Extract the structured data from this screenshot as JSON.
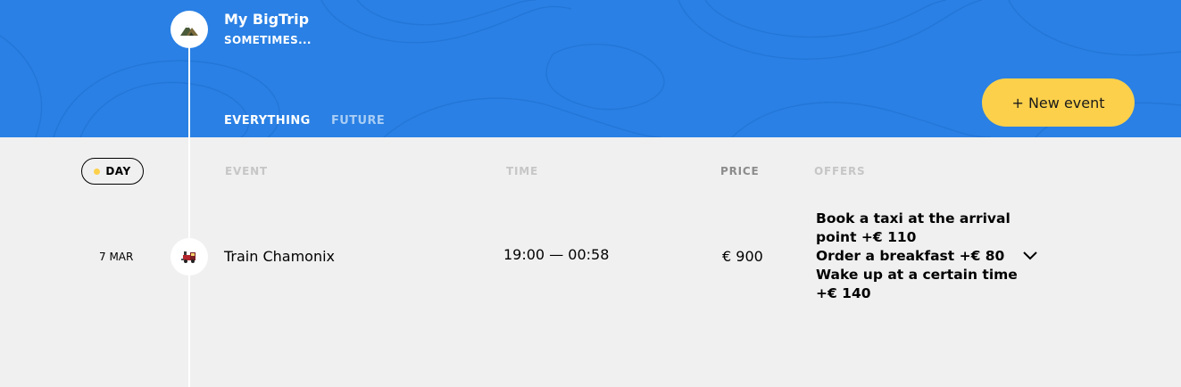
{
  "trip": {
    "title": "My BigTrip",
    "subtitle": "SOMETIMES...",
    "logo_icon": "mountain-icon"
  },
  "filters": [
    {
      "label": "EVERYTHING",
      "active": true
    },
    {
      "label": "FUTURE",
      "active": false
    }
  ],
  "new_event_label": "+ New event",
  "sort": {
    "day_label": "DAY"
  },
  "columns": {
    "event": "EVENT",
    "time": "TIME",
    "price": "PRICE",
    "offers": "OFFERS"
  },
  "events": [
    {
      "date": "7 MAR",
      "type_icon": "train-icon",
      "title": "Train Chamonix",
      "time": "19:00 — 00:58",
      "price": "€ 900",
      "offers": [
        "Book a taxi at the arrival point +€  110",
        "Order a breakfast +€  80",
        "Wake up at a certain time +€  140"
      ]
    }
  ],
  "colors": {
    "header": "#2a80e4",
    "accent": "#fcd04b",
    "background": "#f0f0f0"
  }
}
